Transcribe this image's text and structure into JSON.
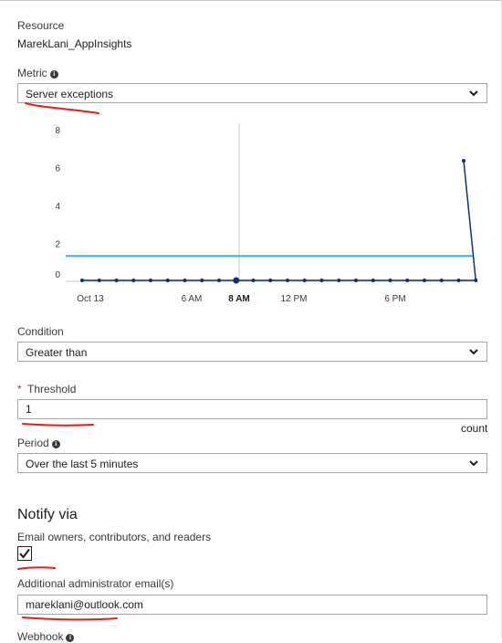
{
  "resource": {
    "label": "Resource",
    "value": "MarekLani_AppInsights"
  },
  "metric": {
    "label": "Metric",
    "selected": "Server exceptions"
  },
  "chart_data": {
    "type": "line",
    "title": "",
    "xlabel": "",
    "ylabel": "",
    "y_ticks": [
      "8",
      "6",
      "4",
      "2",
      "0"
    ],
    "ylim": [
      0,
      8
    ],
    "x_ticks": [
      "Oct 13",
      "6 AM",
      "8 AM",
      "12 PM",
      "6 PM"
    ],
    "threshold_value": 1,
    "threshold_color": "#3ab2ec",
    "series_color": "#0c2f7a",
    "series": [
      {
        "values": [
          0,
          0,
          0,
          0,
          0,
          0,
          0,
          0,
          0,
          0,
          0,
          0,
          0,
          0,
          0,
          0,
          0,
          0,
          0,
          0,
          0,
          0,
          0,
          0,
          6.7
        ]
      }
    ],
    "grid": false
  },
  "condition": {
    "label": "Condition",
    "selected": "Greater than"
  },
  "threshold": {
    "required_mark": "*",
    "label": "Threshold",
    "value": "1",
    "unit": "count"
  },
  "period": {
    "label": "Period",
    "selected": "Over the last 5 minutes"
  },
  "notify": {
    "heading": "Notify via",
    "email_owners_label": "Email owners, contributors, and readers",
    "email_owners_checked": true,
    "additional_email_label": "Additional administrator email(s)",
    "additional_email_value": "mareklani@outlook.com",
    "webhook_label": "Webhook"
  },
  "icons": {
    "info": "info-icon",
    "chevron": "chevron-down-icon",
    "check": "checkmark-icon"
  },
  "colors": {
    "annotation": "#e02020",
    "accent_line": "#3ab2ec",
    "series": "#0c2f7a"
  }
}
